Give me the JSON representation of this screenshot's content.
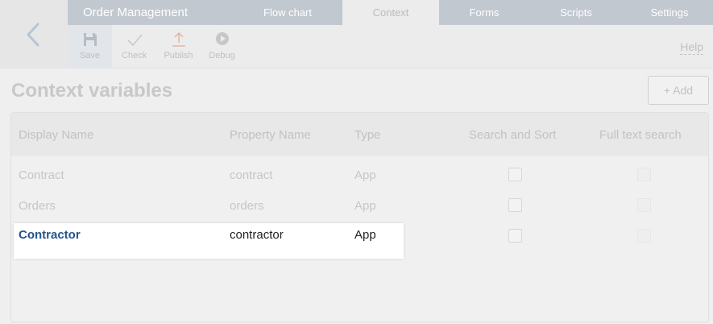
{
  "header": {
    "app_title": "Order Management",
    "tabs": [
      {
        "label": "Flow chart",
        "active": false
      },
      {
        "label": "Context",
        "active": true
      },
      {
        "label": "Forms",
        "active": false
      },
      {
        "label": "Scripts",
        "active": false
      },
      {
        "label": "Settings",
        "active": false
      }
    ]
  },
  "toolbar": {
    "save_label": "Save",
    "check_label": "Check",
    "publish_label": "Publish",
    "debug_label": "Debug",
    "help_label": "Help"
  },
  "main": {
    "title": "Context variables",
    "add_label": "+ Add",
    "columns": [
      "Display Name",
      "Property Name",
      "Type",
      "Search and Sort",
      "Full text search"
    ],
    "rows": [
      {
        "display_name": "Contract",
        "property_name": "contract",
        "type": "App"
      },
      {
        "display_name": "Orders",
        "property_name": "orders",
        "type": "App"
      },
      {
        "display_name": "Contractor",
        "property_name": "contractor",
        "type": "App",
        "highlighted": true
      }
    ]
  },
  "colors": {
    "tab_bar": "#c2c8d0",
    "link": "#26548e",
    "background": "#efefef"
  }
}
